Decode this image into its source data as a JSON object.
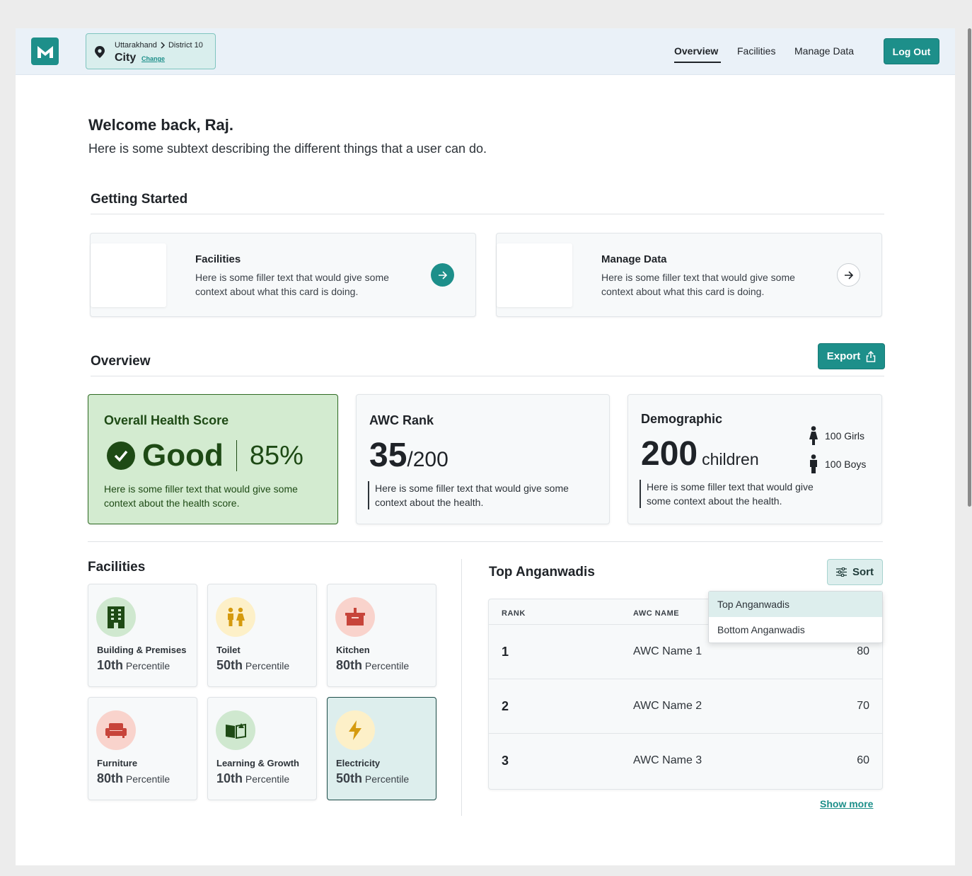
{
  "header": {
    "location": {
      "state": "Uttarakhand",
      "district": "District 10",
      "city": "City",
      "change_label": "Change"
    },
    "nav": [
      {
        "label": "Overview",
        "active": true
      },
      {
        "label": "Facilities",
        "active": false
      },
      {
        "label": "Manage Data",
        "active": false
      }
    ],
    "logout_label": "Log Out"
  },
  "welcome": {
    "title": "Welcome back, Raj.",
    "subtitle": "Here is some subtext describing the different things that a user can do."
  },
  "getting_started": {
    "title": "Getting Started",
    "cards": [
      {
        "title": "Facilities",
        "desc": "Here is some filler text that would give some context about what this card is doing."
      },
      {
        "title": "Manage Data",
        "desc": "Here is some filler text that would give some context about what this card is doing."
      }
    ]
  },
  "overview": {
    "title": "Overview",
    "export_label": "Export",
    "health": {
      "title": "Overall Health Score",
      "status": "Good",
      "percent": "85%",
      "desc": "Here is some filler text that would give some context about the health score."
    },
    "rank": {
      "title": "AWC Rank",
      "value": "35",
      "total": "/200",
      "desc": "Here is some filler text that would give some context about the health."
    },
    "demographic": {
      "title": "Demographic",
      "value": "200",
      "unit": "children",
      "girls": "100 Girls",
      "boys": "100 Boys",
      "desc": "Here is some filler text that would give some context about the health."
    }
  },
  "facilities": {
    "title": "Facilities",
    "suffix": "Percentile",
    "tiles": [
      {
        "name": "Building & Premises",
        "rank": "10th",
        "icon": "building-icon",
        "bg": "#cfe8cf"
      },
      {
        "name": "Toilet",
        "rank": "50th",
        "icon": "toilet-icon",
        "bg": "#fdf0c8"
      },
      {
        "name": "Kitchen",
        "rank": "80th",
        "icon": "kitchen-icon",
        "bg": "#f9d3cc"
      },
      {
        "name": "Furniture",
        "rank": "80th",
        "icon": "sofa-icon",
        "bg": "#f9d3cc"
      },
      {
        "name": "Learning & Growth",
        "rank": "10th",
        "icon": "book-icon",
        "bg": "#cfe8cf"
      },
      {
        "name": "Electricity",
        "rank": "50th",
        "icon": "lightning-icon",
        "bg": "#fdf0c8",
        "selected": true
      }
    ]
  },
  "top_anganwadis": {
    "title": "Top Anganwadis",
    "sort_label": "Sort",
    "columns": {
      "rank": "RANK",
      "name": "AWC NAME"
    },
    "rows": [
      {
        "rank": "1",
        "name": "AWC Name 1",
        "score": "80"
      },
      {
        "rank": "2",
        "name": "AWC Name 2",
        "score": "70"
      },
      {
        "rank": "3",
        "name": "AWC Name 3",
        "score": "60"
      }
    ],
    "sort_options": [
      {
        "label": "Top Anganwadis",
        "active": true
      },
      {
        "label": "Bottom Anganwadis",
        "active": false
      }
    ],
    "show_more_label": "Show more"
  },
  "colors": {
    "brand": "#1d8f8a",
    "health_green": "#1e4a15",
    "health_bg": "#d3ebd0"
  }
}
